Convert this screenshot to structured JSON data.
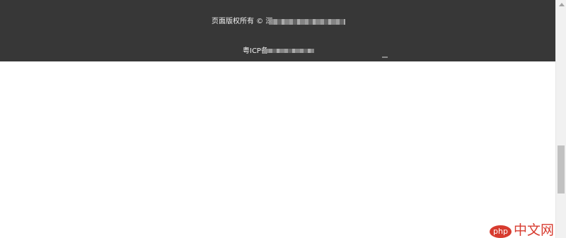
{
  "footer": {
    "copyright_prefix": "页面版权所有 © 深",
    "icp_prefix": "粤ICP备"
  },
  "watermark": {
    "logo": "php",
    "text": "中文网"
  },
  "colors": {
    "footer_background": "#373737",
    "page_background": "#ffffff",
    "watermark": "#d73b2f"
  }
}
